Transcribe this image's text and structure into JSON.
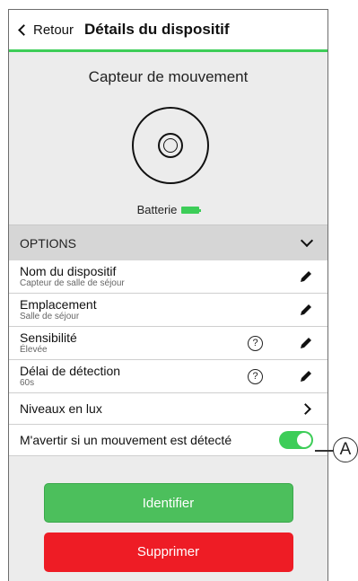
{
  "header": {
    "back_label": "Retour",
    "title": "Détails du dispositif"
  },
  "device": {
    "name": "Capteur de mouvement",
    "battery_label": "Batterie",
    "battery_level": "full"
  },
  "options": {
    "title": "OPTIONS",
    "rows": [
      {
        "label": "Nom du dispositif",
        "value": "Capteur de salle de séjour"
      },
      {
        "label": "Emplacement",
        "value": "Salle de séjour"
      },
      {
        "label": "Sensibilité",
        "value": "Élevée"
      },
      {
        "label": "Délai de détection",
        "value": "60s"
      },
      {
        "label": "Niveaux en lux"
      },
      {
        "label": "M'avertir si un mouvement est détecté",
        "toggle_on": true
      }
    ]
  },
  "help_glyph": "?",
  "actions": {
    "identify": "Identifier",
    "delete": "Supprimer"
  },
  "callout_label": "A",
  "colors": {
    "accent": "#3dcd58",
    "danger": "#ee1c25"
  }
}
